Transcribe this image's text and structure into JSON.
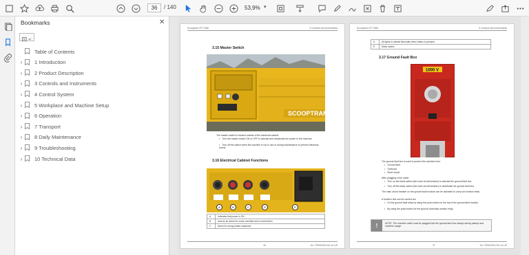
{
  "toolbar": {
    "page_current": "36",
    "page_total": "/ 140",
    "zoom": "53,9%"
  },
  "bookmarks": {
    "title": "Bookmarks",
    "items": [
      {
        "label": "Table of Contents",
        "expandable": false
      },
      {
        "label": "1 Introduction",
        "expandable": true
      },
      {
        "label": "2 Product Description",
        "expandable": true
      },
      {
        "label": "3 Controls and Instruments",
        "expandable": true
      },
      {
        "label": "4 Control System",
        "expandable": true
      },
      {
        "label": "5 Workplace and Machine Setup",
        "expandable": true
      },
      {
        "label": "6 Operation",
        "expandable": true
      },
      {
        "label": "7 Transport",
        "expandable": true
      },
      {
        "label": "8 Daily Maintenance",
        "expandable": true
      },
      {
        "label": "9 Troubleshooting",
        "expandable": true
      },
      {
        "label": "10 Technical Data",
        "expandable": true
      }
    ]
  },
  "left_page": {
    "header_left": "Scooptram ST7 B&E",
    "header_right": "3 Controls and Instruments",
    "sec1_title": "3.15  Master Switch",
    "photo1_brand": "SCOOPTRAM",
    "sec1_body": "The master switch is located outside of the electrical cabinet.",
    "sec1_bullets": [
      "Turn the master switch ON or OFF to activate and deactivate the power to the machine.",
      "Turn off the switch when the machine is not in use or during maintenance to prevent electrical shorts."
    ],
    "sec2_title": "3.16  Electrical Cabinet Functions",
    "callouts": [
      "A",
      "B",
      "C",
      "D",
      "E"
    ],
    "table": [
      [
        "A",
        "Indicates that power is ON"
      ],
      [
        "B",
        "Acts as an alarm for motor overload and a reset button"
      ],
      [
        "C",
        "Alarm for wrong phase sequence"
      ]
    ],
    "footer_left": "36",
    "footer_right": "No. T00000032.001 en-US"
  },
  "right_page": {
    "header_left": "Scooptram ST7 B&E",
    "header_right": "3 Controls and Instruments",
    "table": [
      [
        "D",
        "All lights in cabinet illuminate when button is pressed"
      ],
      [
        "E",
        "Motor switch"
      ]
    ],
    "sec_title": "3.17  Ground Fault Box",
    "photo_label": "1000 V",
    "body1": "The ground fault box is used to protect the machine from:",
    "bullets1": [
      "Ground fault",
      "Overload",
      "Short circuit"
    ],
    "body2": "After plugging in the cable:",
    "bullets2": [
      "Turn on the black switch (the main circuit breaker) to activate the ground fault box.",
      "Turn off the black switch (the main circuit breaker) to deactivate the ground fault box."
    ],
    "body3": "The main circuit breaker on the ground fault module can be activated to carry out function tests.",
    "body4": "A function test can be carried out:",
    "bullets3": [
      "On the ground fault relay by using the push-button on the top of the ground fault module.",
      "By using the push-button for the ground continuity monitor relay."
    ],
    "note_text": "NOTE: The machine cable must be plugged into the ground fault box always during startup and machine usage.",
    "footer_left": "37",
    "footer_right": "No. T00000032.001 en-US"
  },
  "colors": {
    "machine_yellow": "#e9b71d",
    "fault_box_red": "#c8281e",
    "note_gray": "#8a8a8a"
  }
}
